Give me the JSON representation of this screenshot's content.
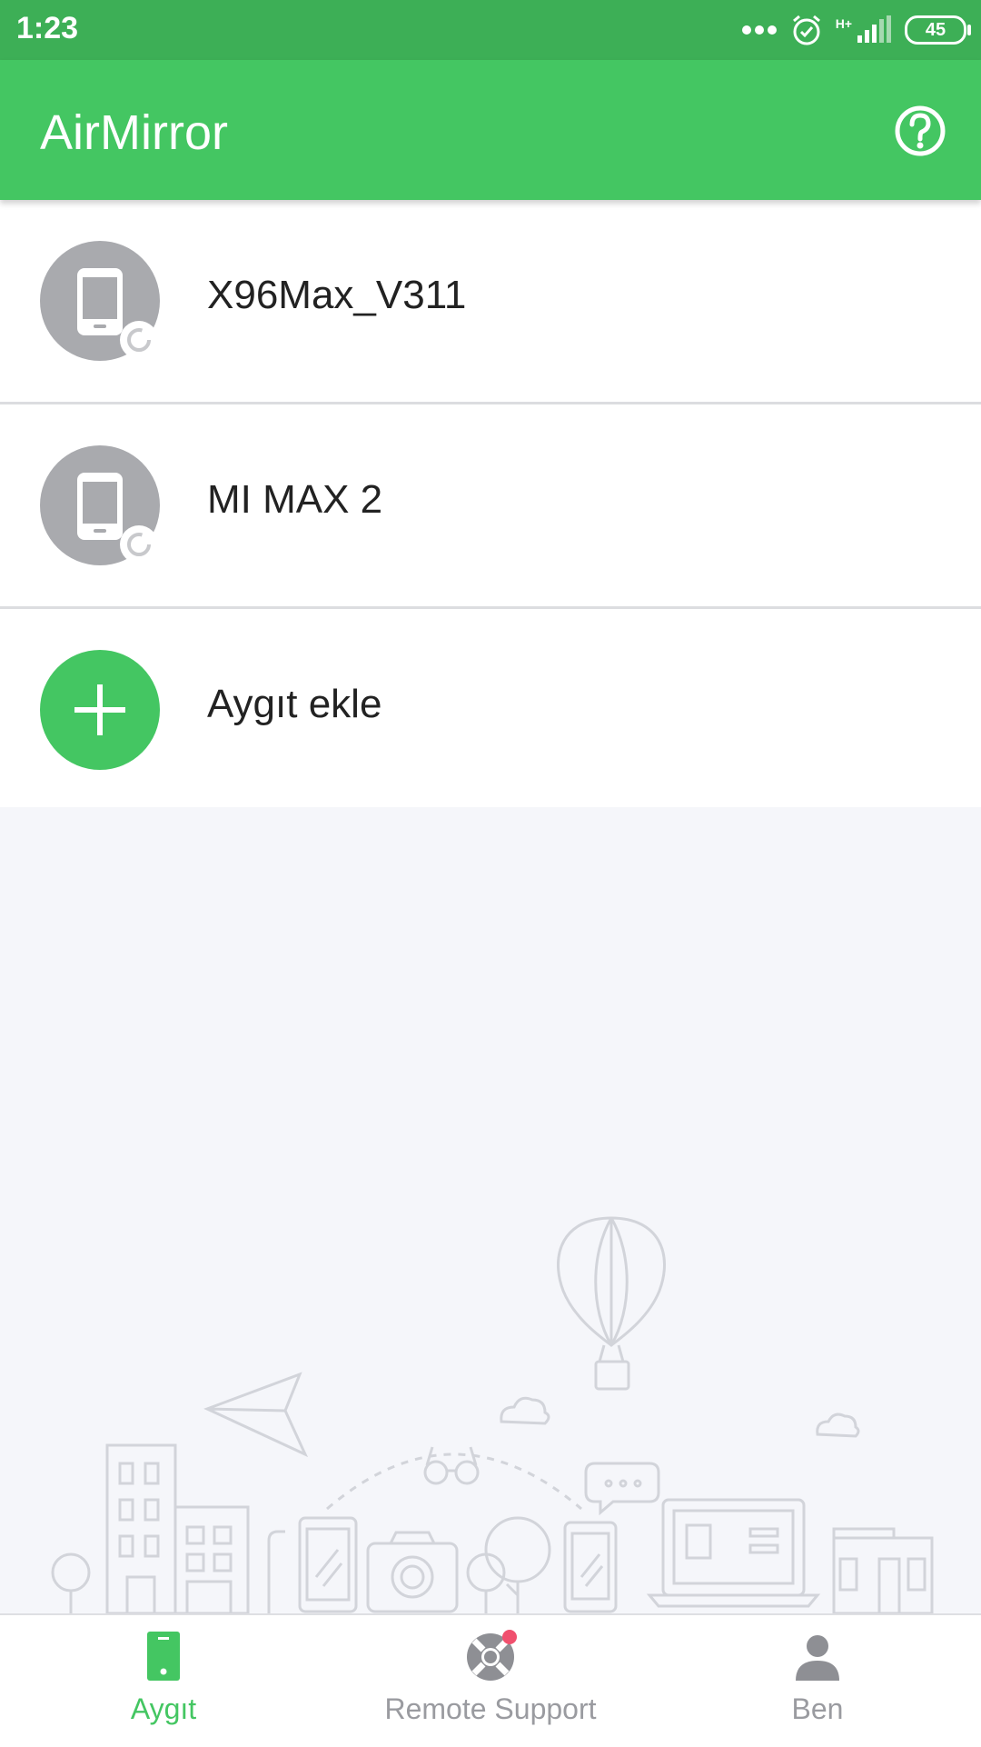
{
  "status_bar": {
    "time": "1:23",
    "network": "H+",
    "battery": "45"
  },
  "app_bar": {
    "title": "AirMirror",
    "help_icon": "help-circle-icon"
  },
  "devices": [
    {
      "name": "X96Max_V311",
      "icon": "phone-icon",
      "status_icon": "loading-spinner-icon"
    },
    {
      "name": "MI MAX 2",
      "icon": "phone-icon",
      "status_icon": "loading-spinner-icon"
    }
  ],
  "add_device": {
    "label": "Aygıt ekle",
    "icon": "plus-icon"
  },
  "tabs": [
    {
      "label": "Aygıt",
      "icon": "phone-icon",
      "active": true
    },
    {
      "label": "Remote Support",
      "icon": "lifebuoy-icon",
      "badge": true
    },
    {
      "label": "Ben",
      "icon": "person-icon"
    }
  ],
  "colors": {
    "status_bar": "#3daf56",
    "app_bar": "#44c662",
    "accent": "#44c662",
    "badge": "#f0506e",
    "device_avatar": "#a9aaae",
    "background": "#f5f6fa"
  }
}
